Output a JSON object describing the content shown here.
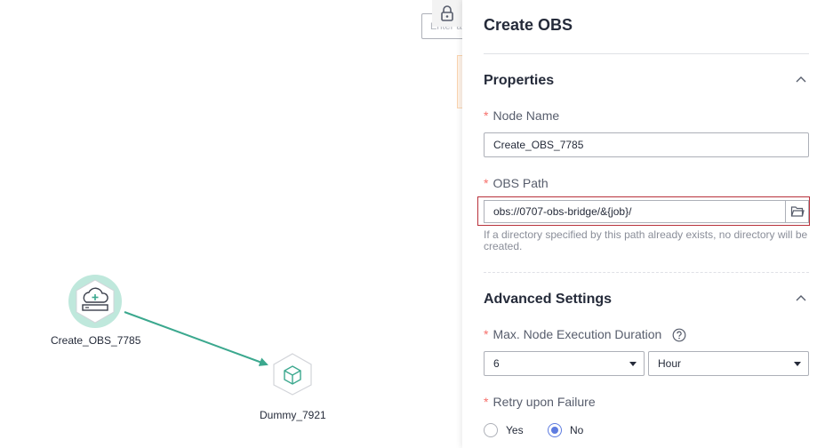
{
  "canvas": {
    "search_placeholder": "Enter a keyword",
    "nodes": [
      {
        "label": "Create_OBS_7785",
        "icon": "cloud-storage-icon"
      },
      {
        "label": "Dummy_7921",
        "icon": "cube-icon"
      }
    ],
    "link_color": "#3ba88e"
  },
  "panel": {
    "title": "Create OBS",
    "properties": {
      "title": "Properties",
      "node_name": {
        "label": "Node Name",
        "value": "Create_OBS_7785"
      },
      "obs_path": {
        "label": "OBS Path",
        "value": "obs://0707-obs-bridge/&{job}/",
        "hint": "If a directory specified by this path already exists, no directory will be created."
      }
    },
    "advanced": {
      "title": "Advanced Settings",
      "max_duration": {
        "label": "Max. Node Execution Duration",
        "value": "6",
        "unit": "Hour"
      },
      "retry": {
        "label": "Retry upon Failure",
        "options": [
          "Yes",
          "No"
        ],
        "selected": "No"
      }
    }
  }
}
